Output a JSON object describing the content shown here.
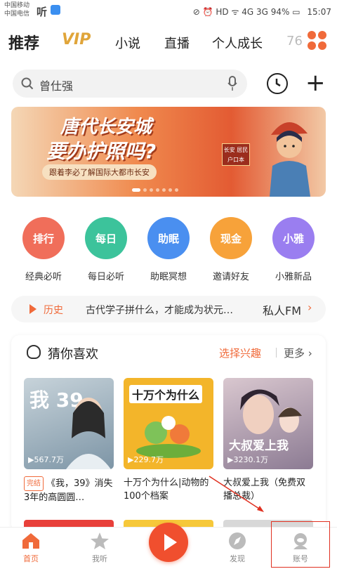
{
  "status_bar": {
    "carrier1": "中国移动",
    "carrier2": "中国电信",
    "app_label": "听",
    "indicators": "⊘ ⏰ HD ᯤ 4G 3G 94% ▭",
    "time": "15:07"
  },
  "top_nav": {
    "tabs": [
      "推荐",
      "VIP",
      "小说",
      "直播",
      "个人成长",
      "76"
    ],
    "active": "推荐"
  },
  "search": {
    "placeholder": "曾仕强"
  },
  "banner": {
    "line1": "唐代长安城",
    "line2": "要办护照吗?",
    "subtitle": "跟着李必了解国际大都市长安",
    "sign": "长安 居民户口本"
  },
  "categories": [
    {
      "circle_text": "排行",
      "label": "经典必听",
      "color": "#f06e5a"
    },
    {
      "circle_text": "每日",
      "label": "每日必听",
      "color": "#3cc39b"
    },
    {
      "circle_text": "助眠",
      "label": "助眠冥想",
      "color": "#4a8ff0"
    },
    {
      "circle_text": "现金",
      "label": "邀请好友",
      "color": "#f7a23a"
    },
    {
      "circle_text": "小雅",
      "label": "小雅新品",
      "color": "#9a7ef0"
    }
  ],
  "history": {
    "label": "历史",
    "text": "古代学子拼什么，才能成为状元…",
    "fm": "私人FM",
    "arrow": "›"
  },
  "recommend": {
    "title": "猜你喜欢",
    "pick": "选择兴趣",
    "more": "更多 ›",
    "items": [
      {
        "plays": "▶567.7万",
        "badge": "完结",
        "title": "《我，39》消失3年的高圆圆…",
        "cover_text": "我 39",
        "color": "#9bb4c4"
      },
      {
        "plays": "▶229.7万",
        "badge": "",
        "title": "十万个为什么|动物的100个档案",
        "cover_text": "十万个为什么",
        "color": "#f3b52a"
      },
      {
        "plays": "▶3230.1万",
        "badge": "",
        "title": "大叔爱上我（免费双播总裁）",
        "cover_text": "大叔爱上我",
        "color": "#b9a3b7"
      }
    ]
  },
  "tab_bar": {
    "tabs": [
      {
        "label": "首页",
        "active": true
      },
      {
        "label": "我听",
        "active": false
      },
      {
        "label": "发现",
        "active": false
      },
      {
        "label": "账号",
        "active": false
      }
    ]
  },
  "colors": {
    "accent": "#f06a3a",
    "annotation": "#e03020"
  }
}
